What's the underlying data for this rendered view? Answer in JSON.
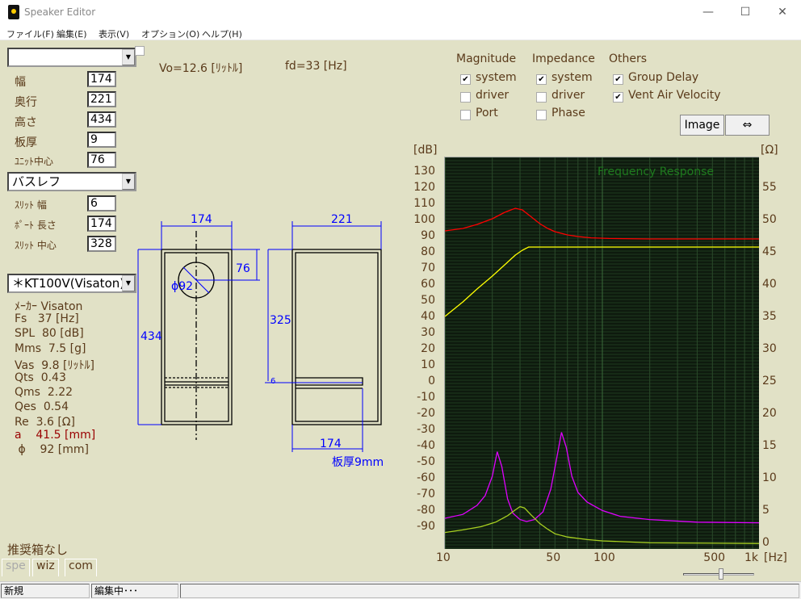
{
  "window": {
    "title": "Speaker Editor",
    "minimize": "—",
    "maximize": "☐",
    "close": "✕"
  },
  "menu": [
    "ファイル(F)",
    "編集(E)",
    "表示(V)",
    "オプション(O)",
    "ヘルプ(H)"
  ],
  "left": {
    "preset_combo": "",
    "fields": [
      {
        "label": "幅",
        "value": "174"
      },
      {
        "label": "奥行",
        "value": "221"
      },
      {
        "label": "高さ",
        "value": "434"
      },
      {
        "label": "板厚",
        "value": "9"
      },
      {
        "label": "ﾕﾆｯﾄ中心",
        "value": "76"
      }
    ],
    "type_combo": "バスレフ",
    "port_fields": [
      {
        "label": "ｽﾘｯﾄ 幅",
        "value": "6"
      },
      {
        "label": "ﾎﾟｰﾄ 長さ",
        "value": "174"
      },
      {
        "label": "ｽﾘｯﾄ 中心",
        "value": "328"
      }
    ],
    "driver_combo": "＊KT100V(Visaton)",
    "specs": [
      "ﾒｰｶｰ Visaton",
      "Fs   37 [Hz]",
      "SPL  80 [dB]",
      "Mms  7.5 [g]",
      "Vas  9.8 [ﾘｯﾄﾙ]",
      "Qts  0.43",
      "Qms  2.22",
      "Qes  0.54",
      "Re  3.6 [Ω]"
    ],
    "a_spec": "a    41.5 [mm]",
    "phi_spec": " ϕ    92 [mm]",
    "recommend": "推奨箱なし",
    "tabs": [
      "spe",
      "wiz",
      "com"
    ]
  },
  "info": {
    "vo": "Vo=12.6 [ﾘｯﾄﾙ]",
    "fd": "fd=33 [Hz]"
  },
  "drawing": {
    "front_width": "174",
    "depth": "221",
    "height": "434",
    "unit_center": "76",
    "diameter": "ϕ92",
    "port_pos": "325",
    "slit": "6",
    "port_len": "174",
    "thickness": "板厚9mm",
    "line_color": "#0000ff"
  },
  "options": {
    "magnitude": {
      "title": "Magnitude",
      "items": [
        {
          "label": "system",
          "checked": true
        },
        {
          "label": "driver",
          "checked": false
        },
        {
          "label": "Port",
          "checked": false
        }
      ]
    },
    "impedance": {
      "title": "Impedance",
      "items": [
        {
          "label": "system",
          "checked": true
        },
        {
          "label": "driver",
          "checked": false
        },
        {
          "label": "Phase",
          "checked": false
        }
      ]
    },
    "others": {
      "title": "Others",
      "items": [
        {
          "label": "Group Delay",
          "checked": true
        },
        {
          "label": "Vent Air Velocity",
          "checked": true
        }
      ]
    },
    "image_button": "Image",
    "swap_button": "⇔"
  },
  "status": [
    "新規",
    "編集中･･･",
    ""
  ],
  "chart_data": {
    "type": "line",
    "title": "Frequency Response",
    "xlabel": "[Hz]",
    "ylabel": "[dB]",
    "y2label": "[Ω]",
    "xscale": "log",
    "xlim": [
      10,
      1000
    ],
    "ylim": [
      -100,
      140
    ],
    "y2lim": [
      0,
      60
    ],
    "xticks": [
      {
        "v": 10,
        "t": "10"
      },
      {
        "v": 50,
        "t": "50"
      },
      {
        "v": 100,
        "t": "100"
      },
      {
        "v": 500,
        "t": "500"
      },
      {
        "v": 1000,
        "t": "1k"
      }
    ],
    "yticks": [
      130,
      120,
      110,
      100,
      90,
      80,
      70,
      60,
      50,
      40,
      30,
      20,
      10,
      0,
      -10,
      -20,
      -30,
      -40,
      -50,
      -60,
      -70,
      -80,
      -90
    ],
    "y2ticks": [
      55,
      50,
      45,
      40,
      35,
      30,
      25,
      20,
      15,
      10,
      5,
      0
    ],
    "grid": true,
    "series": [
      {
        "axis": "left",
        "color": "#ff0000",
        "points": [
          [
            10,
            94
          ],
          [
            13,
            95.5
          ],
          [
            16,
            98
          ],
          [
            20,
            101.5
          ],
          [
            24,
            105.5
          ],
          [
            28,
            108
          ],
          [
            31,
            107
          ],
          [
            35,
            103
          ],
          [
            40,
            98.5
          ],
          [
            45,
            95.5
          ],
          [
            50,
            93.5
          ],
          [
            60,
            91.5
          ],
          [
            70,
            90.5
          ],
          [
            85,
            89.7
          ],
          [
            110,
            89.3
          ],
          [
            200,
            89
          ],
          [
            1000,
            89
          ]
        ]
      },
      {
        "axis": "left",
        "color": "#ffff00",
        "points": [
          [
            10,
            41
          ],
          [
            13,
            50
          ],
          [
            16,
            58
          ],
          [
            20,
            66
          ],
          [
            24,
            73
          ],
          [
            28,
            79
          ],
          [
            31,
            82
          ],
          [
            34,
            84
          ],
          [
            1000,
            84
          ]
        ]
      },
      {
        "axis": "right",
        "color": "#e000ff",
        "points": [
          [
            10,
            4
          ],
          [
            13,
            4.6
          ],
          [
            16,
            6
          ],
          [
            18,
            7.5
          ],
          [
            20,
            10.5
          ],
          [
            21.5,
            14.3
          ],
          [
            23,
            12
          ],
          [
            25,
            7
          ],
          [
            27,
            4.8
          ],
          [
            30,
            3.8
          ],
          [
            33,
            3.5
          ],
          [
            37,
            3.8
          ],
          [
            42,
            5
          ],
          [
            47,
            8.5
          ],
          [
            51,
            13
          ],
          [
            55,
            17.3
          ],
          [
            59,
            15
          ],
          [
            64,
            10.5
          ],
          [
            70,
            8
          ],
          [
            80,
            6.5
          ],
          [
            100,
            5.2
          ],
          [
            130,
            4.3
          ],
          [
            200,
            3.8
          ],
          [
            400,
            3.4
          ],
          [
            1000,
            3.3
          ]
        ]
      },
      {
        "axis": "right",
        "color": "#a8d020",
        "points": [
          [
            10,
            1.8
          ],
          [
            13,
            2.2
          ],
          [
            17,
            2.7
          ],
          [
            21,
            3.4
          ],
          [
            25,
            4.4
          ],
          [
            28,
            5.3
          ],
          [
            30,
            5.8
          ],
          [
            32,
            5.6
          ],
          [
            35,
            4.6
          ],
          [
            40,
            3.2
          ],
          [
            45,
            2.3
          ],
          [
            50,
            1.6
          ],
          [
            60,
            1.1
          ],
          [
            80,
            0.7
          ],
          [
            100,
            0.5
          ],
          [
            200,
            0.2
          ],
          [
            1000,
            0.1
          ]
        ]
      }
    ]
  }
}
